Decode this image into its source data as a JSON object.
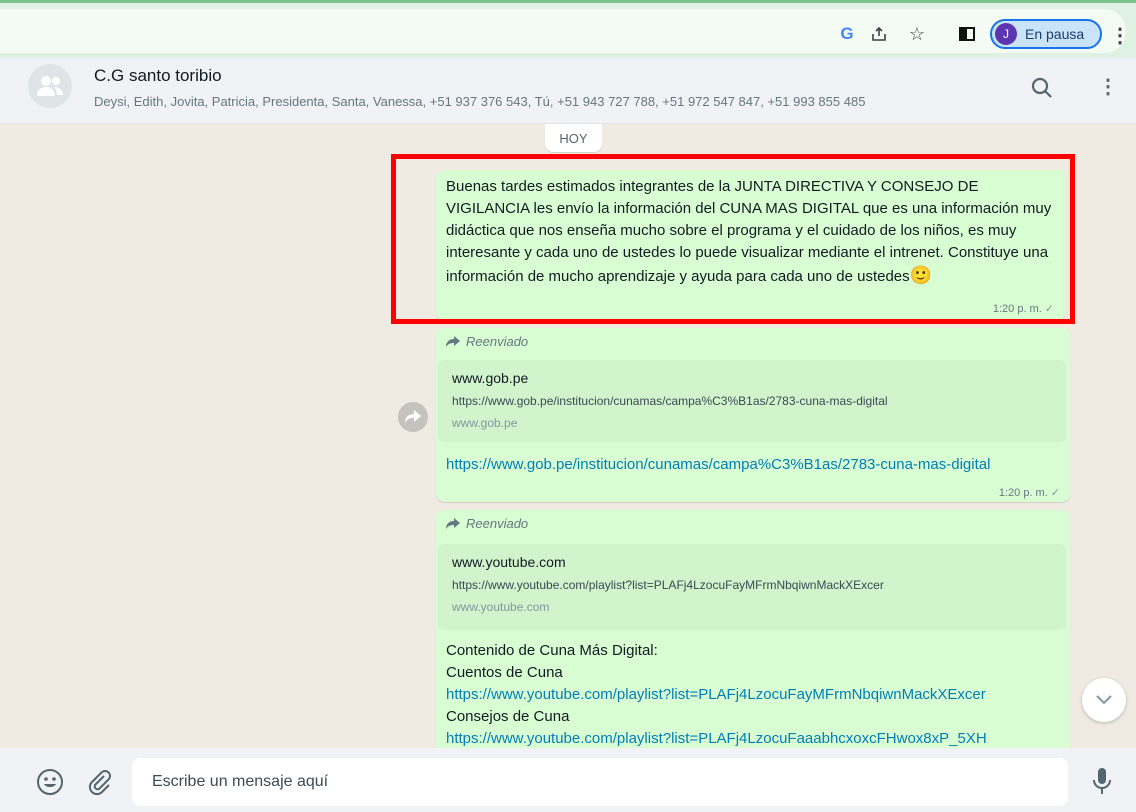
{
  "browser": {
    "google_letter": "G",
    "profile_initial": "J",
    "profile_label": "En pausa"
  },
  "chat": {
    "name": "C.G santo toribio",
    "members": "Deysi, Edith, Jovita, Patricia, Presidenta, Santa, Vanessa, +51 937 376 543, Tú, +51 943 727 788, +51 972 547 847, +51 993 855 485"
  },
  "conversation": {
    "date_chip": "HOY",
    "messages": [
      {
        "text": "Buenas tardes estimados integrantes de la JUNTA DIRECTIVA Y CONSEJO DE VIGILANCIA les envío la información del CUNA MAS DIGITAL que es una información muy didáctica que nos enseña mucho sobre el programa y el cuidado de los niños, es muy interesante y cada uno de ustedes lo puede visualizar mediante el intrenet. Constituye una información de mucho aprendizaje y ayuda para cada uno de ustedes",
        "emoji": "🙂",
        "time": "1:20 p. m.",
        "tick": "✓"
      },
      {
        "forwarded_label": "Reenviado",
        "preview_title": "www.gob.pe",
        "preview_url": "https://www.gob.pe/institucion/cunamas/campa%C3%B1as/2783-cuna-mas-digital",
        "preview_domain": "www.gob.pe",
        "link": "https://www.gob.pe/institucion/cunamas/campa%C3%B1as/2783-cuna-mas-digital",
        "time": "1:20 p. m.",
        "tick": "✓"
      },
      {
        "forwarded_label": "Reenviado",
        "preview_title": "www.youtube.com",
        "preview_url": "https://www.youtube.com/playlist?list=PLAFj4LzocuFayMFrmNbqiwnMackXExcer",
        "preview_domain": "www.youtube.com",
        "line1": "Contenido de Cuna Más Digital:",
        "line2": "Cuentos de Cuna",
        "link1": "https://www.youtube.com/playlist?list=PLAFj4LzocuFayMFrmNbqiwnMackXExcer",
        "line3": "Consejos de Cuna",
        "link2": "https://www.youtube.com/playlist?list=PLAFj4LzocuFaaabhcxoxcFHwox8xP_5XH"
      }
    ]
  },
  "composer": {
    "placeholder": "Escribe un mensaje aquí"
  },
  "colors": {
    "bubble_outgoing": "#d9fdd3",
    "highlight": "#ff0000",
    "link": "#027eb5"
  }
}
